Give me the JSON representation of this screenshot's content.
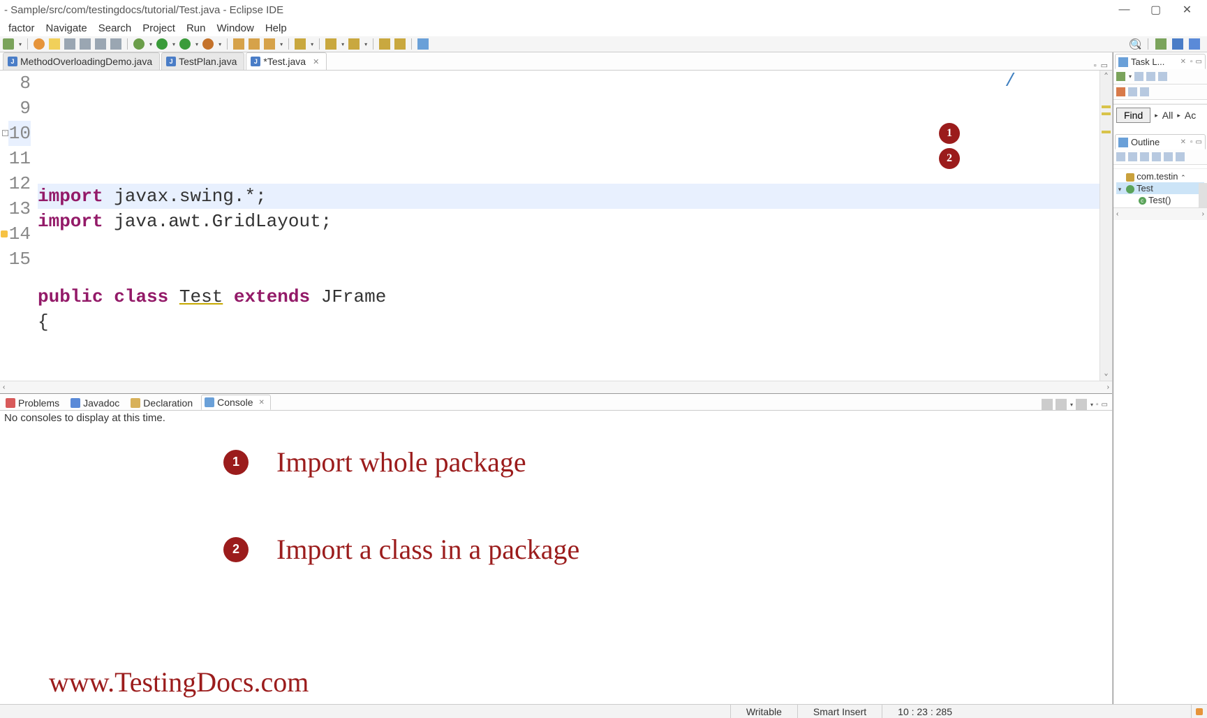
{
  "window": {
    "title": "- Sample/src/com/testingdocs/tutorial/Test.java - Eclipse IDE"
  },
  "menu": [
    "factor",
    "Navigate",
    "Search",
    "Project",
    "Run",
    "Window",
    "Help"
  ],
  "tabs": [
    {
      "label": "MethodOverloadingDemo.java",
      "active": false,
      "dirty": false,
      "closable": false
    },
    {
      "label": "TestPlan.java",
      "active": false,
      "dirty": false,
      "closable": false
    },
    {
      "label": "*Test.java",
      "active": true,
      "dirty": true,
      "closable": true
    }
  ],
  "editor_lines": [
    {
      "num": "8",
      "html": ""
    },
    {
      "num": "9",
      "html": ""
    },
    {
      "num": "10",
      "html": "<span class='kw'>import</span> javax.swing.*;",
      "cur": true
    },
    {
      "num": "11",
      "html": "<span class='kw'>import</span> java.awt.GridLayout;"
    },
    {
      "num": "12",
      "html": ""
    },
    {
      "num": "13",
      "html": ""
    },
    {
      "num": "14",
      "html": "<span class='kw'>public</span> <span class='kw'>class</span> <span class='under'>Test</span> <span class='kw'>extends</span> JFrame"
    },
    {
      "num": "15",
      "html": "{"
    }
  ],
  "code_markers": [
    {
      "num": "1",
      "line_index": 2
    },
    {
      "num": "2",
      "line_index": 3
    }
  ],
  "console_tabs": [
    {
      "label": "Problems",
      "icon_bg": "#d85a5a"
    },
    {
      "label": "Javadoc",
      "icon_bg": "#5a8ad8"
    },
    {
      "label": "Declaration",
      "icon_bg": "#d8b15a"
    },
    {
      "label": "Console",
      "icon_bg": "#6aa0d8",
      "active": true,
      "closable": true
    }
  ],
  "console_msg": "No consoles to display at this time.",
  "annotations": [
    {
      "num": "1",
      "text": "Import whole package"
    },
    {
      "num": "2",
      "text": "Import a class in a package"
    }
  ],
  "watermark": "www.TestingDocs.com",
  "task_panel": {
    "title": "Task L...",
    "find_label": "Find",
    "filter_all": "All",
    "filter_ac": "Ac"
  },
  "outline": {
    "title": "Outline",
    "items": [
      {
        "depth": 0,
        "label": "com.testin",
        "icon": "pkg",
        "tw": ""
      },
      {
        "depth": 0,
        "label": "Test",
        "icon": "class",
        "tw": "▾",
        "selected": true
      },
      {
        "depth": 1,
        "label": "Test()",
        "icon": "ctor",
        "tw": ""
      }
    ]
  },
  "status": {
    "writable": "Writable",
    "insert": "Smart Insert",
    "pos": "10 : 23 : 285"
  }
}
